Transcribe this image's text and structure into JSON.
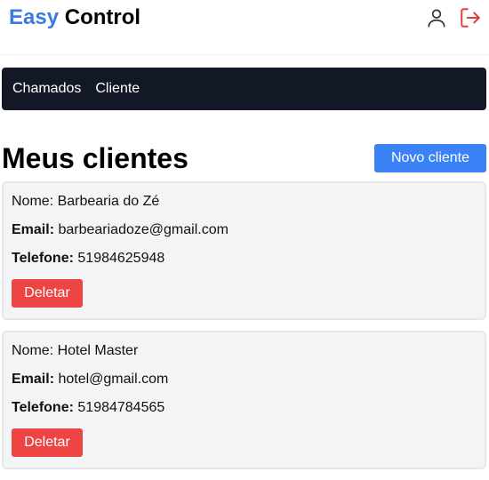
{
  "brand": {
    "part1": "Easy",
    "part2": "Control"
  },
  "header": {
    "icons": [
      "user-icon",
      "logout-icon"
    ],
    "logout_color": "#e53935"
  },
  "nav": {
    "items": [
      {
        "label": "Chamados"
      },
      {
        "label": "Cliente"
      }
    ]
  },
  "page": {
    "title": "Meus clientes",
    "new_button": "Novo cliente"
  },
  "labels": {
    "name": "Nome:",
    "email": "Email:",
    "phone": "Telefone:",
    "delete": "Deletar"
  },
  "clients": [
    {
      "name": "Barbearia do Zé",
      "email": "barbeariadoze@gmail.com",
      "phone": "51984625948"
    },
    {
      "name": "Hotel Master",
      "email": "hotel@gmail.com",
      "phone": "51984784565"
    }
  ],
  "colors": {
    "brand_blue": "#3b7be0",
    "nav_bg": "#121826",
    "primary": "#3b82f6",
    "danger": "#ef4444",
    "card_bg": "#f3f4f6"
  }
}
